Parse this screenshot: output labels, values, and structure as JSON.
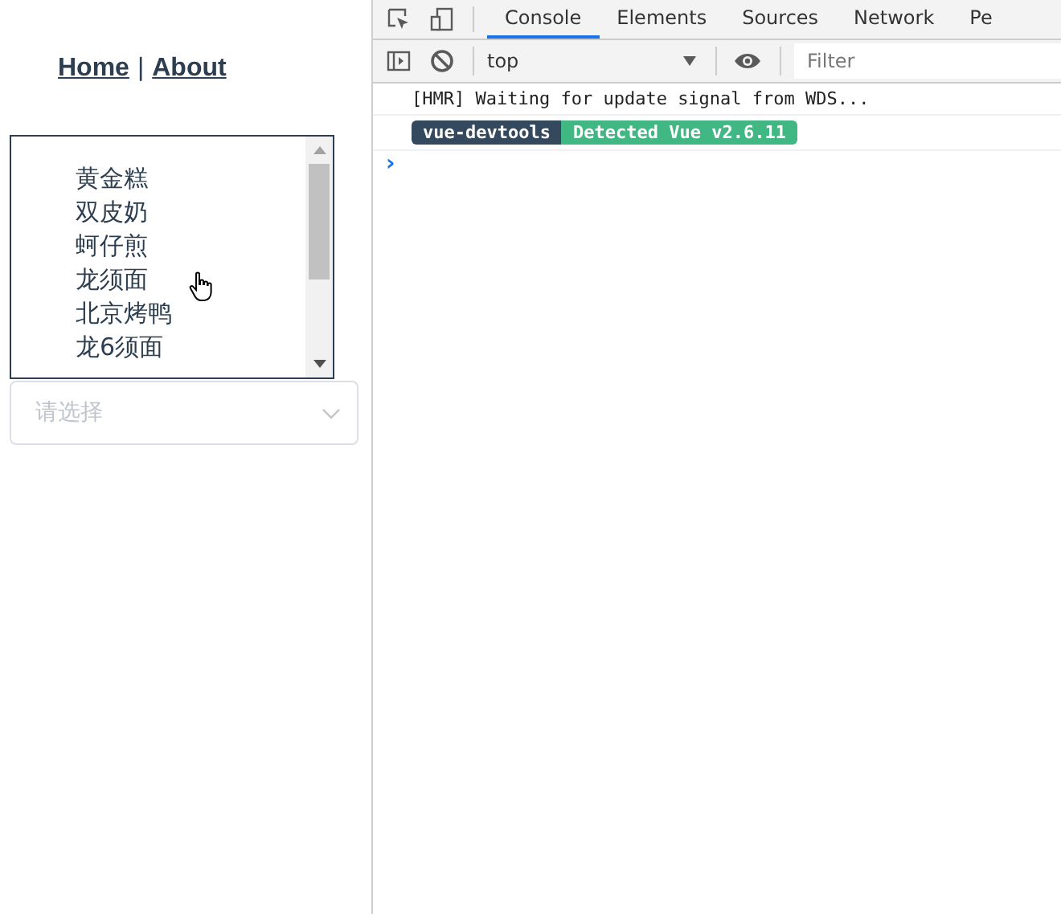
{
  "nav": {
    "links": [
      "Home",
      "About"
    ],
    "separator": "|"
  },
  "listbox": {
    "items": [
      {
        "label": "黄金糕"
      },
      {
        "label": "双皮奶"
      },
      {
        "label": "蚵仔煎"
      },
      {
        "label": "龙须面"
      },
      {
        "label": "北京烤鸭"
      },
      {
        "label": "龙6须面"
      }
    ]
  },
  "select": {
    "placeholder": "请选择"
  },
  "devtools": {
    "tabs": [
      {
        "label": "Console",
        "selected": true
      },
      {
        "label": "Elements",
        "selected": false
      },
      {
        "label": "Sources",
        "selected": false
      },
      {
        "label": "Network",
        "selected": false
      },
      {
        "label": "Pe",
        "selected": false
      }
    ],
    "context": "top",
    "filter": {
      "placeholder": "Filter"
    },
    "messages": [
      {
        "kind": "text",
        "text": "[HMR] Waiting for update signal from WDS..."
      },
      {
        "kind": "badges",
        "badges": [
          {
            "text": "vue-devtools",
            "color": "#35495e"
          },
          {
            "text": "Detected Vue v2.6.11",
            "color": "#41b883"
          }
        ]
      }
    ],
    "prompt": "›"
  }
}
